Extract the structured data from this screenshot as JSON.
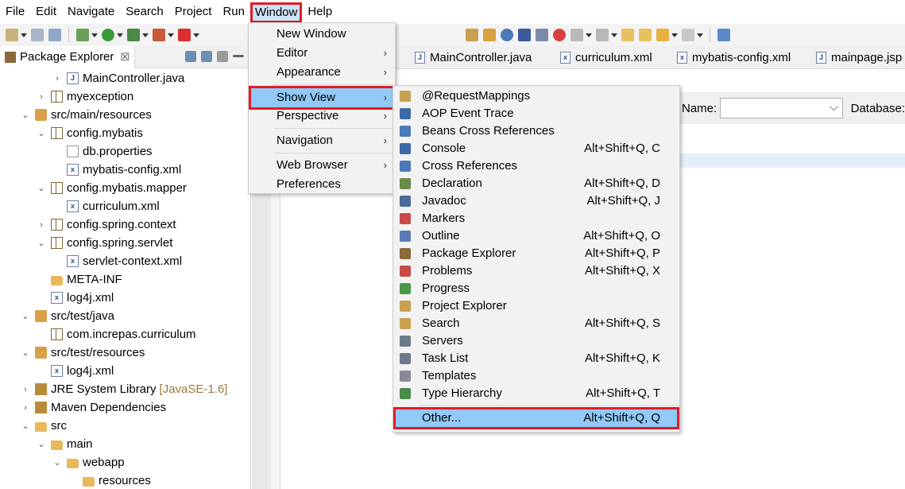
{
  "menubar": {
    "items": [
      "File",
      "Edit",
      "Navigate",
      "Search",
      "Project",
      "Run",
      "Window",
      "Help"
    ],
    "active": "Window"
  },
  "package_explorer": {
    "title": "Package Explorer",
    "close": "☒",
    "tree": [
      {
        "label": "MainController.java",
        "icon": "java-file-icon",
        "expander": "›"
      },
      {
        "label": "myexception",
        "icon": "package-icon",
        "expander": "›"
      },
      {
        "label": "src/main/resources",
        "icon": "source-folder-icon",
        "expander": "⌄"
      },
      {
        "label": "config.mybatis",
        "icon": "package-icon",
        "expander": "⌄"
      },
      {
        "label": "db.properties",
        "icon": "properties-file-icon",
        "expander": ""
      },
      {
        "label": "mybatis-config.xml",
        "icon": "xml-file-icon",
        "expander": ""
      },
      {
        "label": "config.mybatis.mapper",
        "icon": "package-icon",
        "expander": "⌄"
      },
      {
        "label": "curriculum.xml",
        "icon": "xml-file-icon",
        "expander": ""
      },
      {
        "label": "config.spring.context",
        "icon": "package-icon",
        "expander": "›"
      },
      {
        "label": "config.spring.servlet",
        "icon": "package-icon",
        "expander": "⌄"
      },
      {
        "label": "servlet-context.xml",
        "icon": "xml-file-icon",
        "expander": ""
      },
      {
        "label": "META-INF",
        "icon": "folder-icon",
        "expander": ""
      },
      {
        "label": "log4j.xml",
        "icon": "xml-file-icon",
        "expander": ""
      },
      {
        "label": "src/test/java",
        "icon": "source-folder-icon",
        "expander": "⌄"
      },
      {
        "label": "com.increpas.curriculum",
        "icon": "package-icon",
        "expander": ""
      },
      {
        "label": "src/test/resources",
        "icon": "source-folder-icon",
        "expander": "⌄"
      },
      {
        "label": "log4j.xml",
        "icon": "xml-file-icon",
        "expander": ""
      },
      {
        "label": "JRE System Library",
        "icon": "library-icon",
        "expander": "›",
        "suffix": "[JavaSE-1.6]"
      },
      {
        "label": "Maven Dependencies",
        "icon": "library-icon",
        "expander": "›"
      },
      {
        "label": "src",
        "icon": "folder-icon",
        "expander": "⌄"
      },
      {
        "label": "main",
        "icon": "folder-icon",
        "expander": "⌄"
      },
      {
        "label": "webapp",
        "icon": "folder-icon",
        "expander": "⌄"
      },
      {
        "label": "resources",
        "icon": "folder-icon",
        "expander": ""
      }
    ]
  },
  "editor": {
    "tabs": [
      "MainController.java",
      "curriculum.xml",
      "mybatis-config.xml",
      "mainpage.jsp"
    ],
    "name_label": "Name:",
    "database_label": "Database:"
  },
  "window_menu": {
    "items": [
      {
        "label": "New Window",
        "submenu": false
      },
      {
        "label": "Editor",
        "submenu": true
      },
      {
        "label": "Appearance",
        "submenu": true
      },
      {
        "label": "Show View",
        "submenu": true,
        "highlighted": true
      },
      {
        "label": "Perspective",
        "submenu": true
      },
      {
        "label": "Navigation",
        "submenu": true
      },
      {
        "label": "Web Browser",
        "submenu": true
      },
      {
        "label": "Preferences",
        "submenu": false
      }
    ]
  },
  "show_view_menu": {
    "items": [
      {
        "label": "@RequestMappings",
        "shortcut": "",
        "icon": "request-mappings-icon"
      },
      {
        "label": "AOP Event Trace",
        "shortcut": "",
        "icon": "aop-trace-icon"
      },
      {
        "label": "Beans Cross References",
        "shortcut": "",
        "icon": "beans-xref-icon"
      },
      {
        "label": "Console",
        "shortcut": "Alt+Shift+Q, C",
        "icon": "console-icon"
      },
      {
        "label": "Cross References",
        "shortcut": "",
        "icon": "cross-references-icon"
      },
      {
        "label": "Declaration",
        "shortcut": "Alt+Shift+Q, D",
        "icon": "declaration-icon"
      },
      {
        "label": "Javadoc",
        "shortcut": "Alt+Shift+Q, J",
        "icon": "javadoc-icon"
      },
      {
        "label": "Markers",
        "shortcut": "",
        "icon": "markers-icon"
      },
      {
        "label": "Outline",
        "shortcut": "Alt+Shift+Q, O",
        "icon": "outline-icon"
      },
      {
        "label": "Package Explorer",
        "shortcut": "Alt+Shift+Q, P",
        "icon": "package-explorer-icon"
      },
      {
        "label": "Problems",
        "shortcut": "Alt+Shift+Q, X",
        "icon": "problems-icon"
      },
      {
        "label": "Progress",
        "shortcut": "",
        "icon": "progress-icon"
      },
      {
        "label": "Project Explorer",
        "shortcut": "",
        "icon": "project-explorer-icon"
      },
      {
        "label": "Search",
        "shortcut": "Alt+Shift+Q, S",
        "icon": "search-icon"
      },
      {
        "label": "Servers",
        "shortcut": "",
        "icon": "servers-icon"
      },
      {
        "label": "Task List",
        "shortcut": "Alt+Shift+Q, K",
        "icon": "task-list-icon"
      },
      {
        "label": "Templates",
        "shortcut": "",
        "icon": "templates-icon"
      },
      {
        "label": "Type Hierarchy",
        "shortcut": "Alt+Shift+Q, T",
        "icon": "type-hierarchy-icon"
      }
    ],
    "other": {
      "label": "Other...",
      "shortcut": "Alt+Shift+Q, Q"
    }
  },
  "colors": {
    "highlight": "#91c9f7",
    "callout": "#e31b23",
    "menu_bg": "#f2f2f2"
  }
}
